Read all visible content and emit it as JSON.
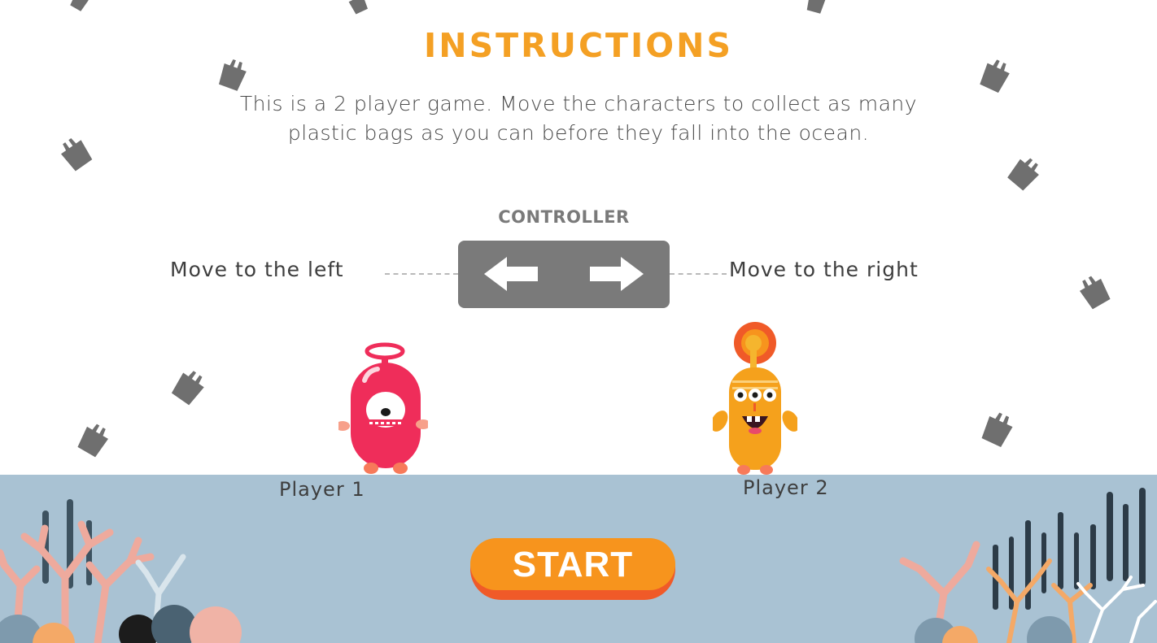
{
  "instructions": {
    "title": "INSTRUCTIONS",
    "line1": "This is a 2 player game.  Move the characters to collect as many",
    "line2": "plastic bags as you can before they fall into the ocean."
  },
  "controller": {
    "label": "CONTROLLER",
    "left_text": "Move to the left",
    "right_text": "Move to the right",
    "left_key_icon": "left-arrow-icon",
    "right_key_icon": "right-arrow-icon"
  },
  "players": [
    {
      "label": "Player 1",
      "color": "#ef2d5a"
    },
    {
      "label": "Player 2",
      "color": "#f5a11c"
    }
  ],
  "start_button": {
    "label": "START"
  },
  "colors": {
    "accent": "#f4a024",
    "ocean": "#a9c2d3",
    "controller_bg": "#7a7a7a",
    "button": "#f7941d",
    "bag": "#6f6f6f"
  }
}
